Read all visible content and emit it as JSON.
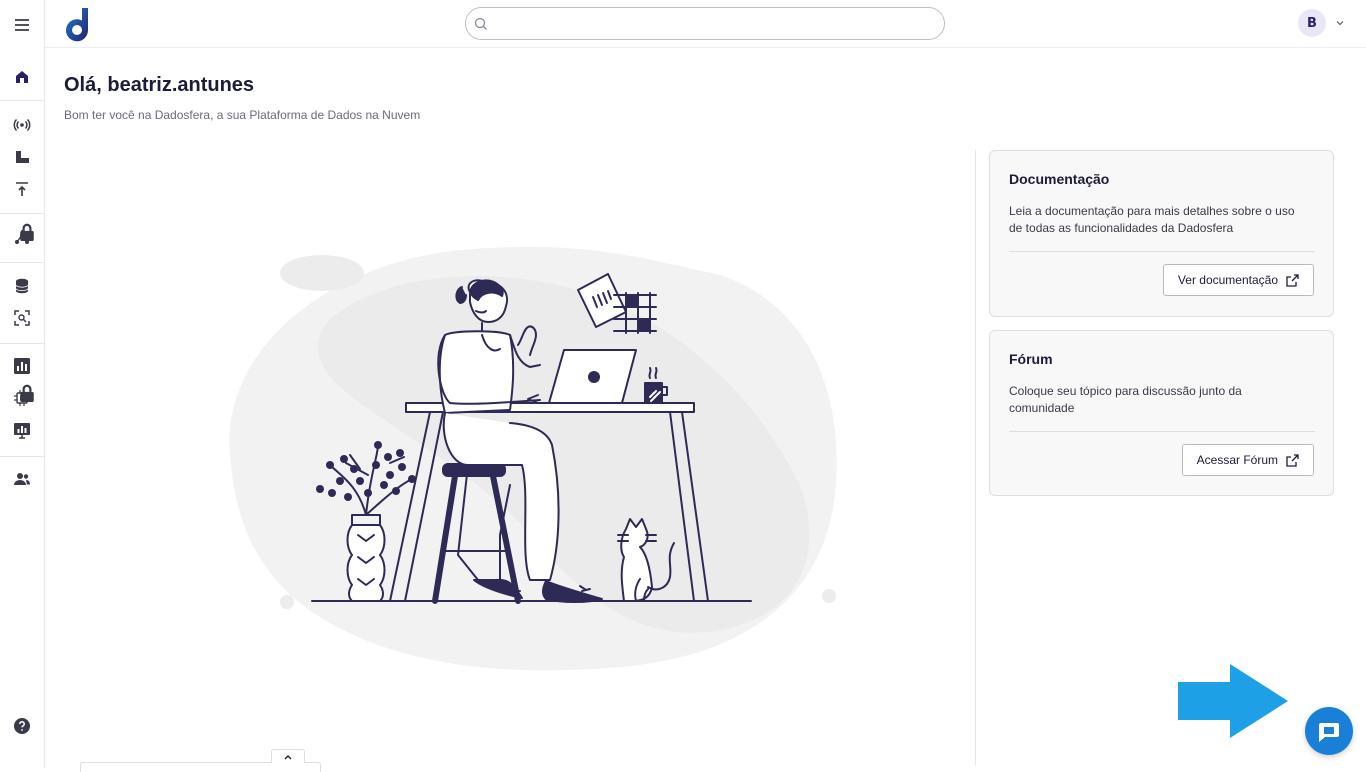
{
  "header": {
    "search": {
      "placeholder": "",
      "value": ""
    },
    "user_initial": "B"
  },
  "sidebar": {
    "items": [
      {
        "name": "menu"
      },
      {
        "name": "home",
        "active": true
      },
      {
        "name": "connections"
      },
      {
        "name": "pipelines"
      },
      {
        "name": "uploads"
      },
      {
        "name": "lineage",
        "locked": true
      },
      {
        "name": "database"
      },
      {
        "name": "data-explorer"
      },
      {
        "name": "analytics"
      },
      {
        "name": "intelligence",
        "locked": true
      },
      {
        "name": "dashboards"
      },
      {
        "name": "users"
      },
      {
        "name": "help"
      }
    ]
  },
  "main": {
    "greeting": "Olá, beatriz.antunes",
    "subtitle": "Bom ter você na Dadosfera, a sua Plataforma de Dados na Nuvem"
  },
  "cards": {
    "docs": {
      "title": "Documentação",
      "text": "Leia a documentação para mais detalhes sobre o uso de todas as funcionalidades da Dadosfera",
      "button": "Ver documentação"
    },
    "forum": {
      "title": "Fórum",
      "text": "Coloque seu tópico para discussão junto da comunidade",
      "button": "Acessar Fórum"
    }
  },
  "colors": {
    "accent": "#2b1f6b",
    "brand_blue": "#1a7fd6",
    "annotation_arrow": "#1ea0e6",
    "illustration_ink": "#2e2a56",
    "blob": "#f2f2f2"
  }
}
